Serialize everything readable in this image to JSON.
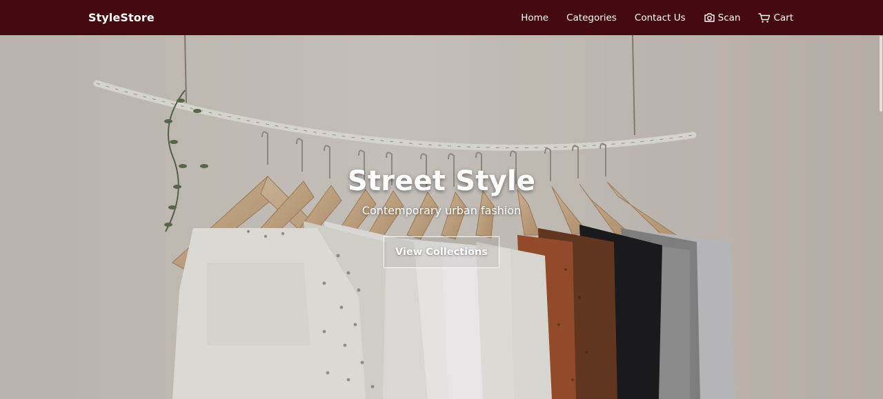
{
  "navbar": {
    "brand": "StyleStore",
    "links": [
      {
        "label": "Home"
      },
      {
        "label": "Categories"
      },
      {
        "label": "Contact Us"
      },
      {
        "label": "Scan",
        "icon": "camera-icon"
      },
      {
        "label": "Cart",
        "icon": "cart-icon"
      }
    ],
    "background": "#440a0f"
  },
  "hero": {
    "title": "Street Style",
    "subtitle": "Contemporary urban fashion",
    "button_label": "View Collections",
    "image": "clothing-rack-photo"
  }
}
